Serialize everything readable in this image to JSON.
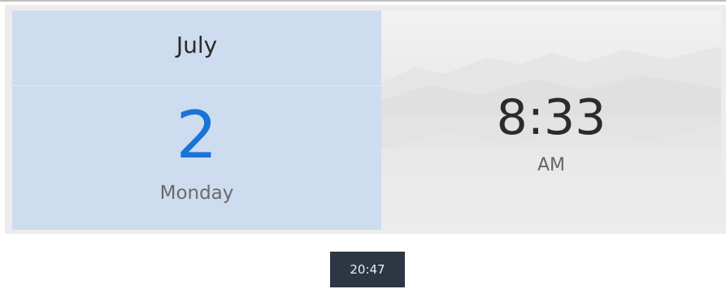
{
  "calendar": {
    "month": "July",
    "day": "2",
    "weekday": "Monday"
  },
  "clock": {
    "time": "8:33",
    "period": "AM"
  },
  "tooltip": {
    "time": "20:47"
  },
  "colors": {
    "date_panel_bg": "#cddcee",
    "day_number": "#1a73d8",
    "tooltip_bg": "#2c3743"
  }
}
